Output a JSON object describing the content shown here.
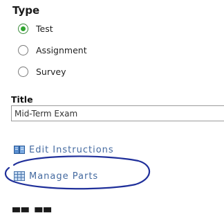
{
  "form": {
    "type_heading": "Type",
    "type_options": [
      {
        "label": "Test",
        "selected": true
      },
      {
        "label": "Assignment",
        "selected": false
      },
      {
        "label": "Survey",
        "selected": false
      }
    ],
    "title_label": "Title",
    "title_value": "Mid-Term Exam",
    "links": [
      {
        "label": "Edit Instructions",
        "icon": "book-icon"
      },
      {
        "label": "Manage Parts",
        "icon": "grid-icon"
      }
    ]
  },
  "colors": {
    "link": "#446aa0",
    "radio_selected": "#2fa52f",
    "annotation": "#1f2f9a"
  }
}
